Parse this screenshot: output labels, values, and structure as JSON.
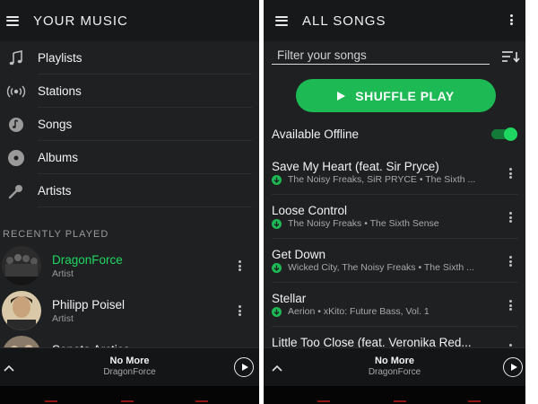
{
  "left": {
    "header": {
      "title": "YOUR MUSIC"
    },
    "nav": [
      {
        "label": "Playlists",
        "icon": "music-note-icon"
      },
      {
        "label": "Stations",
        "icon": "radio-icon"
      },
      {
        "label": "Songs",
        "icon": "song-disc-icon"
      },
      {
        "label": "Albums",
        "icon": "album-icon"
      },
      {
        "label": "Artists",
        "icon": "microphone-icon"
      }
    ],
    "recent_header": "RECENTLY PLAYED",
    "recent": [
      {
        "title": "DragonForce",
        "subtitle": "Artist",
        "active": true
      },
      {
        "title": "Philipp Poisel",
        "subtitle": "Artist",
        "active": false
      },
      {
        "title": "Sonata Arctica",
        "subtitle": "",
        "active": false
      }
    ],
    "now_playing": {
      "title": "No More",
      "artist": "DragonForce"
    }
  },
  "right": {
    "header": {
      "title": "ALL SONGS"
    },
    "filter": {
      "placeholder": "Filter your songs",
      "value": ""
    },
    "shuffle_label": "SHUFFLE PLAY",
    "offline": {
      "label": "Available Offline",
      "enabled": true
    },
    "songs": [
      {
        "title": "Save My Heart (feat. Sir Pryce)",
        "subtitle": "The Noisy Freaks, SiR PRYCE • The Sixth ..."
      },
      {
        "title": "Loose Control",
        "subtitle": "The Noisy Freaks • The Sixth Sense"
      },
      {
        "title": "Get Down",
        "subtitle": "Wicked City, The Noisy Freaks • The Sixth ..."
      },
      {
        "title": "Stellar",
        "subtitle": "Aerion • xKito: Future Bass, Vol. 1"
      },
      {
        "title": "Little Too Close (feat. Veronika Red...",
        "subtitle": ""
      }
    ],
    "now_playing": {
      "title": "No More",
      "artist": "DragonForce"
    }
  },
  "colors": {
    "accent": "#1db954",
    "active_text": "#1ed760",
    "background": "#1f2022",
    "bar": "#17181a"
  }
}
